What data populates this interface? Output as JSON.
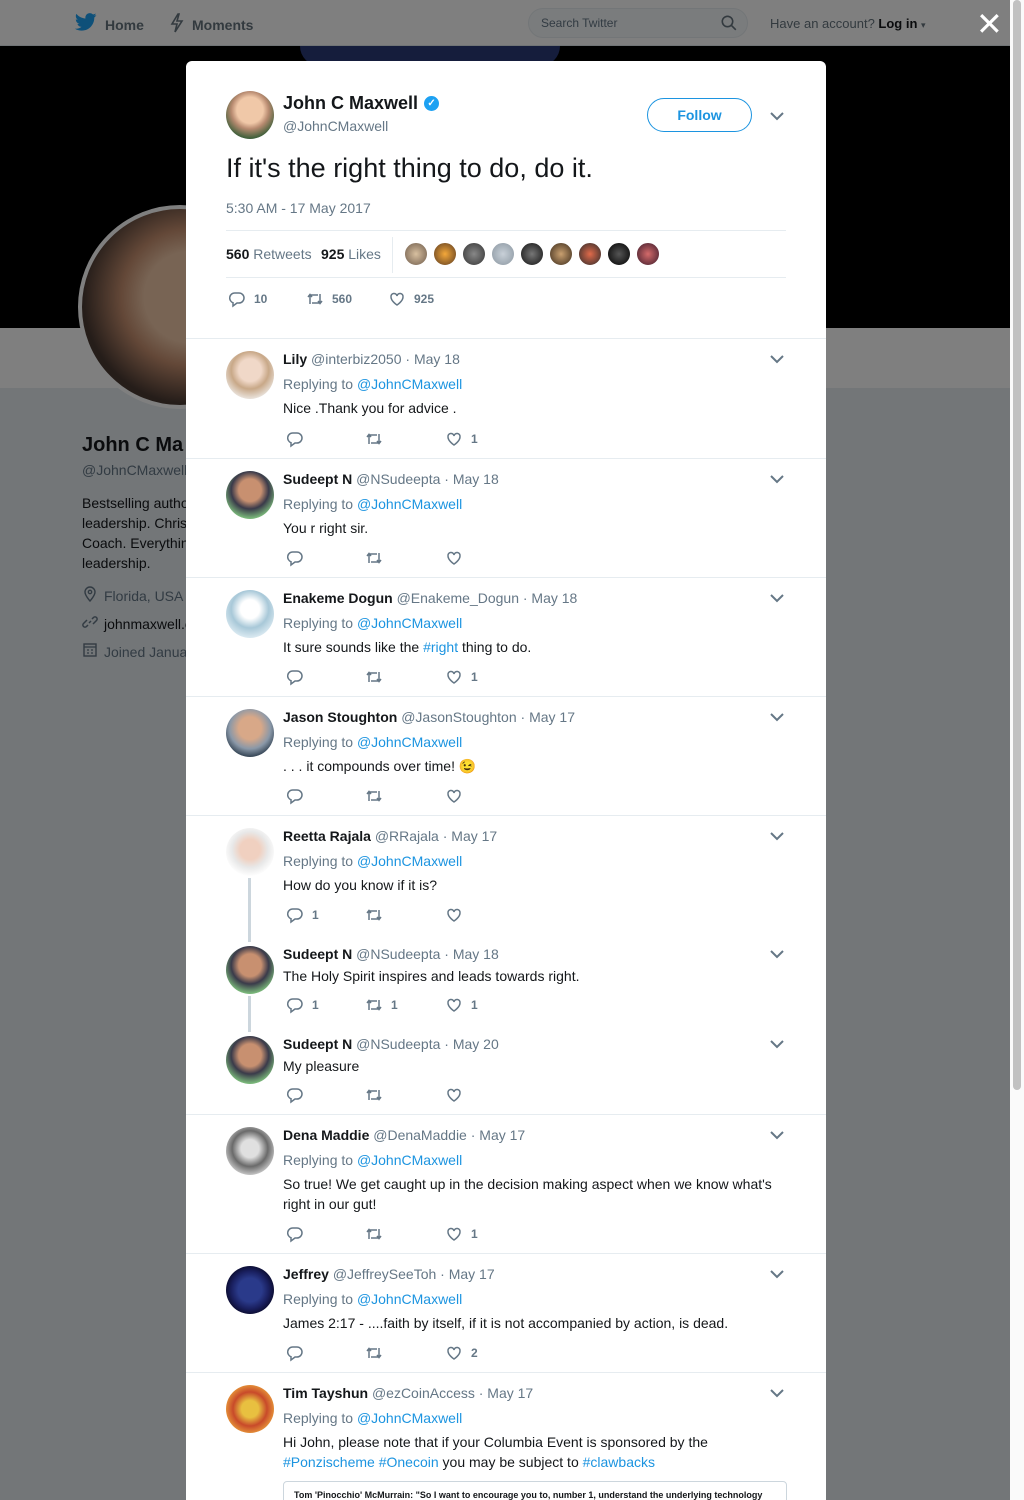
{
  "topbar": {
    "home": "Home",
    "moments": "Moments",
    "search_placeholder": "Search Twitter",
    "have_account": "Have an account?",
    "login": "Log in"
  },
  "profile": {
    "name": "John C Ma",
    "handle": "@JohnCMaxwell",
    "bio_lines": [
      "Bestselling autho",
      "leadership. Chris",
      "Coach. Everythin",
      "leadership."
    ],
    "location": "Florida, USA",
    "website": "johnmaxwell.c",
    "joined": "Joined Janua"
  },
  "tweet": {
    "name": "John C Maxwell",
    "handle": "@JohnCMaxwell",
    "follow_label": "Follow",
    "text": "If it's the right thing to do, do it.",
    "timestamp": "5:30 AM - 17 May 2017",
    "retweets_count": "560",
    "retweets_label": "Retweets",
    "likes_count": "925",
    "likes_label": "Likes",
    "reply_count": "10",
    "retweet_count": "560",
    "like_count": "925"
  },
  "replies": [
    {
      "name": "Lily",
      "meta": "@interbiz2050 · May 18",
      "replying_label": "Replying to",
      "replying_to": "@JohnCMaxwell",
      "text": "Nice .Thank you for advice .",
      "reply_count": "",
      "retweet_count": "",
      "like_count": "1"
    },
    {
      "name": "Sudeept N",
      "meta": "@NSudeepta · May 18",
      "replying_label": "Replying to",
      "replying_to": "@JohnCMaxwell",
      "text": "You r right sir.",
      "reply_count": "",
      "retweet_count": "",
      "like_count": ""
    },
    {
      "name": "Enakeme Dogun",
      "meta": "@Enakeme_Dogun · May 18",
      "replying_label": "Replying to",
      "replying_to": "@JohnCMaxwell",
      "text_before": "It sure sounds like the ",
      "hashtag": "#right",
      "text_after": " thing to do.",
      "reply_count": "",
      "retweet_count": "",
      "like_count": "1"
    },
    {
      "name": "Jason Stoughton",
      "meta": "@JasonStoughton · May 17",
      "replying_label": "Replying to",
      "replying_to": "@JohnCMaxwell",
      "text": ". . . it compounds over time!",
      "emoji": "😉",
      "reply_count": "",
      "retweet_count": "",
      "like_count": ""
    },
    {
      "name": "Reetta Rajala",
      "meta": "@RRajala · May 17",
      "replying_label": "Replying to",
      "replying_to": "@JohnCMaxwell",
      "text": "How do you know if it is?",
      "reply_count": "1",
      "retweet_count": "",
      "like_count": ""
    },
    {
      "name": "Sudeept N",
      "meta": "@NSudeepta · May 18",
      "text": "The Holy Spirit inspires and leads towards right.",
      "reply_count": "1",
      "retweet_count": "1",
      "like_count": "1"
    },
    {
      "name": "Sudeept N",
      "meta": "@NSudeepta · May 20",
      "text": "My pleasure",
      "reply_count": "",
      "retweet_count": "",
      "like_count": ""
    },
    {
      "name": "Dena Maddie",
      "meta": "@DenaMaddie · May 17",
      "replying_label": "Replying to",
      "replying_to": "@JohnCMaxwell",
      "text": "So true! We get caught up in the decision making aspect when we know what's right in our gut!",
      "reply_count": "",
      "retweet_count": "",
      "like_count": "1"
    },
    {
      "name": "Jeffrey",
      "meta": "@JeffreySeeToh · May 17",
      "replying_label": "Replying to",
      "replying_to": "@JohnCMaxwell",
      "text": "James 2:17 - ....faith by itself, if it is not accompanied by action, is dead.",
      "reply_count": "",
      "retweet_count": "",
      "like_count": "2"
    },
    {
      "name": "Tim Tayshun",
      "meta": "@ezCoinAccess · May 17",
      "replying_label": "Replying to",
      "replying_to": "@JohnCMaxwell",
      "text_before": "Hi John, please note that if your Columbia Event is sponsored by the ",
      "hashtag1": "#Ponzischeme",
      "hashtag2": "#Onecoin",
      "text_mid": " you may be subject to ",
      "hashtag3": "#clawbacks",
      "embed": "Tom 'Pinocchio' McMurrain: \"So I want to encourage you to, number 1, understand the underlying technology"
    }
  ],
  "colors": {
    "accent": "#1da1f2",
    "link": "#1c94e0",
    "muted": "#657786"
  }
}
